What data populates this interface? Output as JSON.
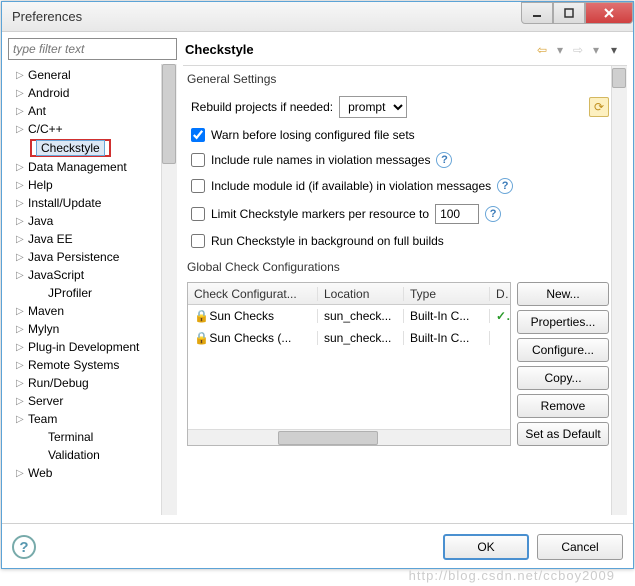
{
  "window": {
    "title": "Preferences"
  },
  "filter": {
    "placeholder": "type filter text"
  },
  "tree": {
    "items": [
      {
        "label": "General",
        "exp": true
      },
      {
        "label": "Android",
        "exp": true
      },
      {
        "label": "Ant",
        "exp": true
      },
      {
        "label": "C/C++",
        "exp": true
      },
      {
        "label": "Checkstyle",
        "exp": false,
        "highlight": true,
        "indent": true
      },
      {
        "label": "Data Management",
        "exp": true
      },
      {
        "label": "Help",
        "exp": true
      },
      {
        "label": "Install/Update",
        "exp": true
      },
      {
        "label": "Java",
        "exp": true
      },
      {
        "label": "Java EE",
        "exp": true
      },
      {
        "label": "Java Persistence",
        "exp": true
      },
      {
        "label": "JavaScript",
        "exp": true
      },
      {
        "label": "JProfiler",
        "exp": false,
        "indent": true
      },
      {
        "label": "Maven",
        "exp": true
      },
      {
        "label": "Mylyn",
        "exp": true
      },
      {
        "label": "Plug-in Development",
        "exp": true
      },
      {
        "label": "Remote Systems",
        "exp": true
      },
      {
        "label": "Run/Debug",
        "exp": true
      },
      {
        "label": "Server",
        "exp": true
      },
      {
        "label": "Team",
        "exp": true
      },
      {
        "label": "Terminal",
        "exp": false,
        "indent": true
      },
      {
        "label": "Validation",
        "exp": false,
        "indent": true
      },
      {
        "label": "Web",
        "exp": true
      }
    ]
  },
  "page": {
    "title": "Checkstyle",
    "general_label": "General Settings",
    "rebuild_label": "Rebuild projects if needed:",
    "rebuild_value": "prompt",
    "warn_label": "Warn before losing configured file sets",
    "warn_checked": true,
    "include_rule_label": "Include rule names in violation messages",
    "include_module_label": "Include module id (if available) in violation messages",
    "limit_label": "Limit Checkstyle markers per resource to",
    "limit_value": "100",
    "background_label": "Run Checkstyle in background on full builds",
    "global_label": "Global Check Configurations",
    "columns": {
      "c1": "Check Configurat...",
      "c2": "Location",
      "c3": "Type",
      "c4": "D"
    },
    "rows": [
      {
        "name": "Sun Checks",
        "loc": "sun_check...",
        "type": "Built-In C...",
        "def": "✓"
      },
      {
        "name": "Sun Checks (...",
        "loc": "sun_check...",
        "type": "Built-In C...",
        "def": ""
      }
    ],
    "buttons": {
      "new": "New...",
      "props": "Properties...",
      "configure": "Configure...",
      "copy": "Copy...",
      "remove": "Remove",
      "default": "Set as Default"
    }
  },
  "footer": {
    "ok": "OK",
    "cancel": "Cancel"
  },
  "watermark": "http://blog.csdn.net/ccboy2009"
}
